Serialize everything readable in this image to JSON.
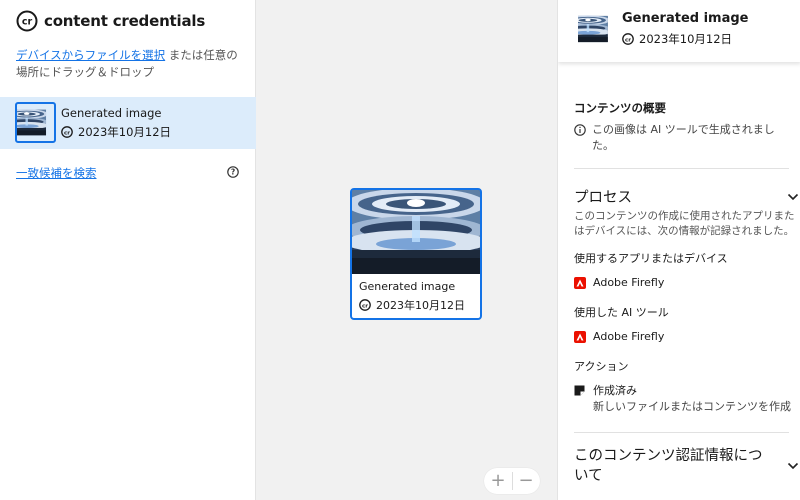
{
  "brand": {
    "name": "content credentials"
  },
  "upload": {
    "link_text": "デバイスからファイルを選択",
    "rest_text": " または任意の場所にドラッグ＆ドロップ"
  },
  "file": {
    "title": "Generated image",
    "date": "2023年10月12日"
  },
  "search": {
    "link_text": "一致候補を検索"
  },
  "canvas": {
    "zoom_in": "+",
    "zoom_out": "−"
  },
  "panel": {
    "title": "Generated image",
    "date": "2023年10月12日",
    "summary": {
      "heading": "コンテンツの概要",
      "text": "この画像は AI ツールで生成されました。"
    },
    "process": {
      "heading": "プロセス",
      "description": "このコンテンツの作成に使用されたアプリまたはデバイスには、次の情報が記録されました。",
      "apps_label": "使用するアプリまたはデバイス",
      "app": "Adobe Firefly",
      "ai_label": "使用した AI ツール",
      "ai_tool": "Adobe Firefly",
      "actions_label": "アクション",
      "action_title": "作成済み",
      "action_desc": "新しいファイルまたはコンテンツを作成"
    },
    "credentials_heading": "このコンテンツ認証情報について"
  },
  "colors": {
    "accent": "#1473e6",
    "selected_bg": "#dcecfb",
    "adobe_red": "#eb1000"
  }
}
